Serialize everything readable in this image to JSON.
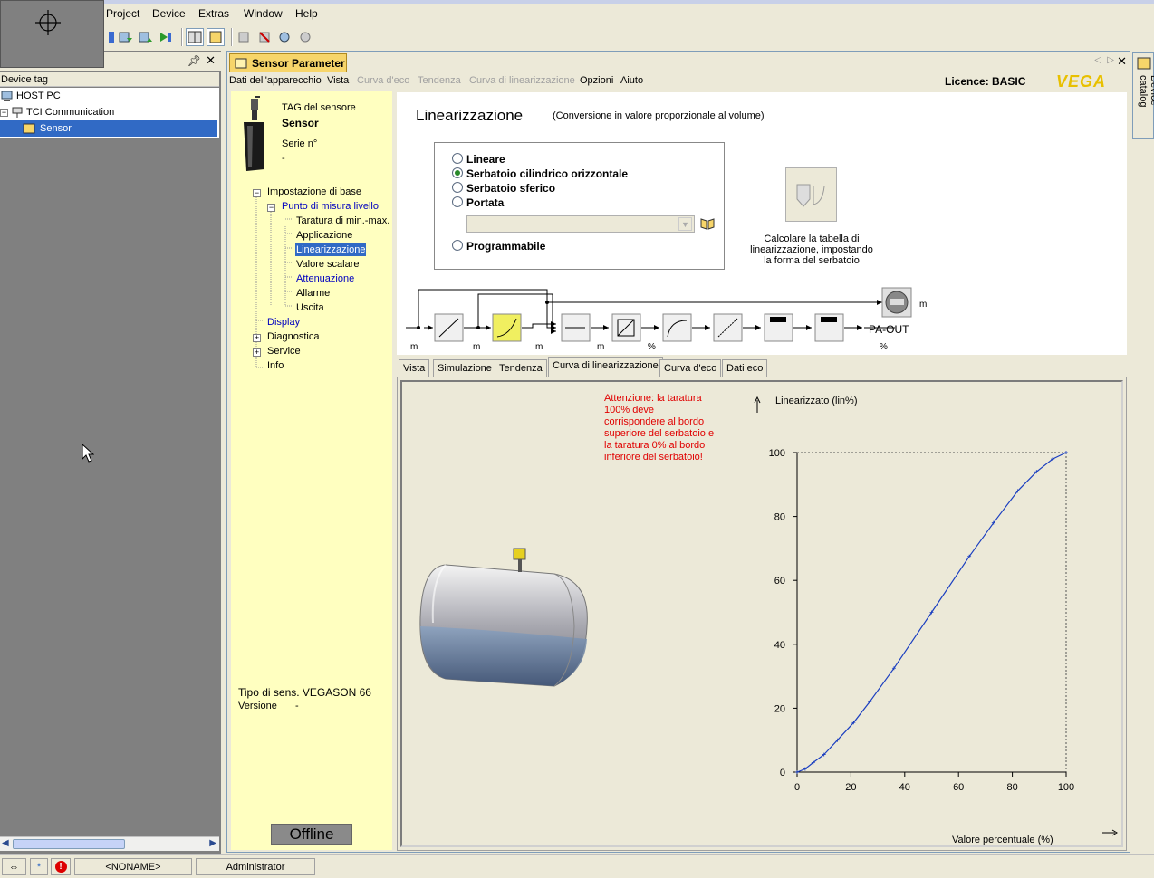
{
  "app": {
    "menus": [
      "Project",
      "Device",
      "Extras",
      "Window",
      "Help"
    ]
  },
  "left": {
    "header": "Device tag",
    "tree": [
      {
        "label": "HOST PC"
      },
      {
        "label": "TCI Communication"
      },
      {
        "label": "Sensor"
      }
    ]
  },
  "doc": {
    "tab_title": "Sensor Parameter",
    "menus": [
      {
        "label": "Dati dell'apparecchio",
        "enabled": true
      },
      {
        "label": "Vista",
        "enabled": true
      },
      {
        "label": "Curva d'eco",
        "enabled": false
      },
      {
        "label": "Tendenza",
        "enabled": false
      },
      {
        "label": "Curva di linearizzazione",
        "enabled": false
      },
      {
        "label": "Opzioni",
        "enabled": true
      },
      {
        "label": "Aiuto",
        "enabled": true
      }
    ],
    "licence": "Licence: BASIC",
    "brand": "VEGA",
    "side_catalog": "Device catalog"
  },
  "nav": {
    "tag_label": "TAG del sensore",
    "tag_value": "Sensor",
    "serial_label": "Serie n°",
    "serial_value": "-",
    "items": [
      "Impostazione di base",
      "Punto di misura livello",
      "Taratura di min.-max.",
      "Applicazione",
      "Linearizzazione",
      "Valore scalare",
      "Attenuazione",
      "Allarme",
      "Uscita",
      "Display",
      "Diagnostica",
      "Service",
      "Info"
    ],
    "sensor_type": "Tipo di sens. VEGASON 66",
    "version_label": "Versione",
    "version_value": "-",
    "offline": "Offline"
  },
  "panel": {
    "title": "Linearizzazione",
    "subtitle": "(Conversione in valore proporzionale al volume)",
    "options": [
      "Lineare",
      "Serbatoio cilindrico orizzontale",
      "Serbatoio sferico",
      "Portata",
      "Programmabile"
    ],
    "selected": 1,
    "calc_text": "Calcolare la tabella di linearizzazione, impostando la forma del serbatoio",
    "flow_units": [
      "m",
      "m",
      "m",
      "m",
      "%",
      "m",
      "%"
    ],
    "pa_out": "PA-OUT"
  },
  "tabs": [
    "Vista",
    "Simulazione",
    "Tendenza",
    "Curva di linearizzazione",
    "Curva d'eco",
    "Dati eco"
  ],
  "active_tab": 3,
  "warning": "Attenzione: la taratura 100% deve corrispondere al bordo superiore del serbatoio e la taratura 0% al bordo inferiore del serbatoio!",
  "chart_data": {
    "type": "line",
    "ylabel": "Linearizzato (lin%)",
    "xlabel": "Valore percentuale (%)",
    "xlim": [
      0,
      100
    ],
    "ylim": [
      0,
      100
    ],
    "xticks": [
      0,
      20,
      40,
      60,
      80,
      100
    ],
    "yticks": [
      0,
      20,
      40,
      60,
      80,
      100
    ],
    "x": [
      0,
      3,
      6,
      10,
      15,
      21,
      27,
      36,
      50,
      64,
      73,
      82,
      89,
      95,
      100
    ],
    "y": [
      0,
      1,
      3,
      5.5,
      10,
      15.5,
      22,
      32.5,
      50,
      67.5,
      78,
      88,
      94,
      98,
      100
    ]
  },
  "status": {
    "project": "<NONAME>",
    "user": "Administrator"
  },
  "colors": {
    "nav_bg": "#ffffc0",
    "warning": "#e00000",
    "selection": "#316ac5",
    "tab_yellow": "#f7d56a"
  }
}
